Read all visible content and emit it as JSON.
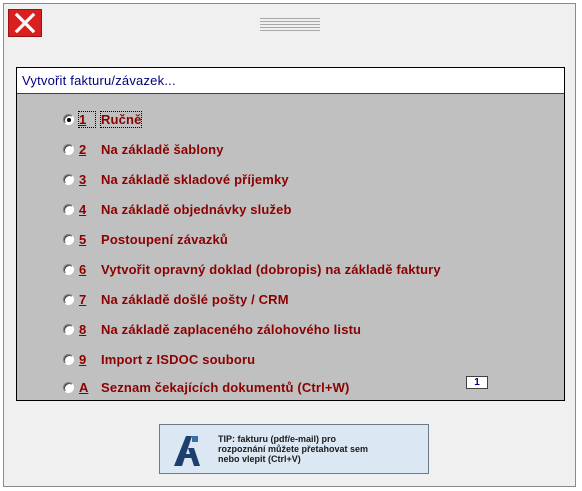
{
  "panel": {
    "title": "Vytvořit fakturu/závazek..."
  },
  "options": [
    {
      "key": "1",
      "label": "Ručně",
      "checked": true
    },
    {
      "key": "2",
      "label": "Na základě šablony",
      "checked": false
    },
    {
      "key": "3",
      "label": "Na základě skladové příjemky",
      "checked": false
    },
    {
      "key": "4",
      "label": "Na základě objednávky služeb",
      "checked": false
    },
    {
      "key": "5",
      "label": "Postoupení závazků",
      "checked": false
    },
    {
      "key": "6",
      "label": "Vytvořit opravný doklad (dobropis) na základě faktury",
      "checked": false
    },
    {
      "key": "7",
      "label": "Na základě došlé pošty / CRM",
      "checked": false
    },
    {
      "key": "8",
      "label": "Na základě zaplaceného zálohového listu",
      "checked": false
    },
    {
      "key": "9",
      "label": "Import z ISDOC souboru",
      "checked": false
    },
    {
      "key": "A",
      "label": "Seznam čekajících dokumentů (Ctrl+W)",
      "checked": false
    }
  ],
  "waiting_count": "1",
  "tip": {
    "line1": "TIP: fakturu (pdf/e-mail) pro",
    "line2": "rozpoznání můžete přetahovat sem",
    "line3": "nebo vlepit (Ctrl+V)"
  },
  "colors": {
    "close": "#d92020",
    "label": "#8b0000",
    "title": "#000080",
    "panel": "#c0c0c0",
    "tip_bg": "#dbe7f3"
  },
  "icons": {
    "close": "close-icon",
    "drag": "drag-grip-icon",
    "tip_logo": "app-logo-icon"
  }
}
